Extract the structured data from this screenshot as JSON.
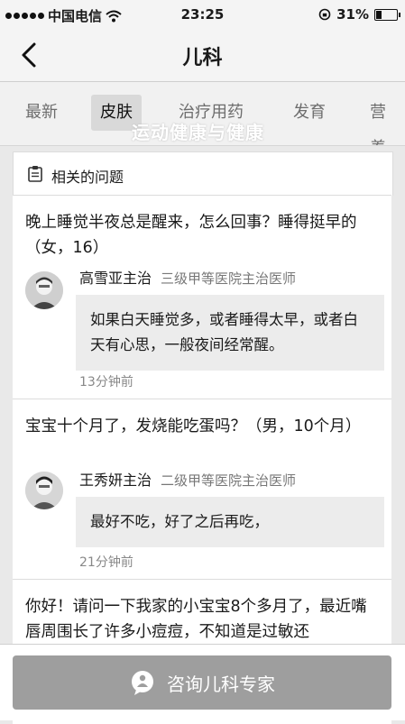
{
  "status_bar": {
    "carrier": "中国电信",
    "time": "23:25",
    "battery": "31%",
    "battery_level": 0.31
  },
  "nav": {
    "title": "儿科"
  },
  "tabs": [
    {
      "label": "最新"
    },
    {
      "label": "皮肤"
    },
    {
      "label": "治疗用药"
    },
    {
      "label": "发育"
    },
    {
      "label": "营养"
    }
  ],
  "active_tab": "皮肤",
  "watermark": "运动健康与健康",
  "section": {
    "label": "相关的问题"
  },
  "questions": [
    {
      "question": "晚上睡觉半夜总是醒来，怎么回事？睡得挺早的（女，16）",
      "doctor_name": "高雪亚主治",
      "doctor_title": "三级甲等医院主治医师",
      "answer": "如果白天睡觉多，或者睡得太早，或者白天有心思，一般夜间经常醒。",
      "time": "13分钟前"
    },
    {
      "question": "宝宝十个月了，发烧能吃蛋吗？（男，10个月）",
      "doctor_name": "王秀妍主治",
      "doctor_title": "二级甲等医院主治医师",
      "answer": "最好不吃，好了之后再吃，",
      "time": "21分钟前"
    },
    {
      "question": "你好！请问一下我家的小宝宝8个多月了，最近嘴唇周围长了许多小痘痘，不知道是过敏还"
    }
  ],
  "consult": {
    "label": "咨询儿科专家"
  }
}
